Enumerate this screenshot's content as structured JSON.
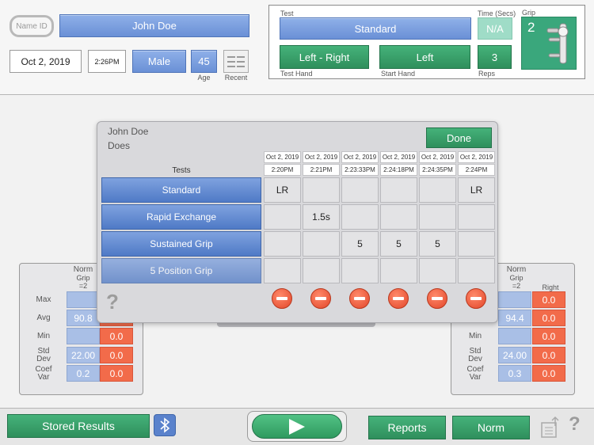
{
  "header": {
    "name_id_label": "Name ID",
    "patient_name": "John Doe",
    "date": "Oct 2, 2019",
    "time": "2:26PM",
    "gender": "Male",
    "age": "45",
    "age_label": "Age",
    "recent_label": "Recent"
  },
  "test_panel": {
    "test_label": "Test",
    "test_value": "Standard",
    "time_label": "Time (Secs)",
    "time_value": "N/A",
    "grip_label": "Grip",
    "grip_value": "2",
    "test_hand_value": "Left - Right",
    "test_hand_label": "Test Hand",
    "start_hand_value": "Left",
    "start_hand_label": "Start Hand",
    "reps_value": "3",
    "reps_label": "Reps"
  },
  "left_stats": {
    "norm_label": "Norm",
    "grip_label": "Grip",
    "grip_eq": "=2",
    "rows": [
      {
        "label": "Max",
        "norm": "",
        "val": ""
      },
      {
        "label": "Avg",
        "norm": "90.8",
        "val": ""
      },
      {
        "label": "Min",
        "norm": "",
        "val": "0.0"
      },
      {
        "label": "Std\nDev",
        "norm": "22.00",
        "val": "0.0"
      },
      {
        "label": "Coef\nVar",
        "norm": "0.2",
        "val": "0.0"
      }
    ]
  },
  "right_stats": {
    "norm_label": "Norm",
    "grip_label": "Grip",
    "grip_eq": "=2",
    "right_label": "Right",
    "rows": [
      {
        "label": "Max",
        "norm": "",
        "val": "0.0"
      },
      {
        "label": "Avg",
        "norm": "94.4",
        "val": "0.0"
      },
      {
        "label": "Min",
        "norm": "",
        "val": "0.0"
      },
      {
        "label": "Std\nDev",
        "norm": "24.00",
        "val": "0.0"
      },
      {
        "label": "Coef\nVar",
        "norm": "0.3",
        "val": "0.0"
      }
    ]
  },
  "dialog": {
    "name": "John Doe",
    "subtitle": "Does",
    "done_label": "Done",
    "tests_header": "Tests",
    "columns": [
      {
        "date": "Oct 2, 2019",
        "time": "2:20PM"
      },
      {
        "date": "Oct 2, 2019",
        "time": "2:21PM"
      },
      {
        "date": "Oct 2, 2019",
        "time": "2:23:33PM"
      },
      {
        "date": "Oct 2, 2019",
        "time": "2:24:18PM"
      },
      {
        "date": "Oct 2, 2019",
        "time": "2:24:35PM"
      },
      {
        "date": "Oct 2, 2019",
        "time": "2:24PM"
      }
    ],
    "rows": [
      {
        "name": "Standard",
        "cells": [
          "LR",
          "",
          "",
          "",
          "",
          "LR"
        ]
      },
      {
        "name": "Rapid Exchange",
        "cells": [
          "",
          "1.5s",
          "",
          "",
          "",
          ""
        ]
      },
      {
        "name": "Sustained Grip",
        "cells": [
          "",
          "",
          "5",
          "5",
          "5",
          ""
        ]
      },
      {
        "name": "5 Position Grip",
        "cells": [
          "",
          "",
          "",
          "",
          "",
          ""
        ]
      }
    ],
    "help_glyph": "?"
  },
  "footer": {
    "stored_results_label": "Stored Results",
    "reports_label": "Reports",
    "norm_label": "Norm",
    "help_glyph": "?"
  },
  "colors": {
    "blue": "#6a90d6",
    "green": "#2f8f5c",
    "red": "#f26b4a",
    "mint": "#9fdcc7"
  }
}
